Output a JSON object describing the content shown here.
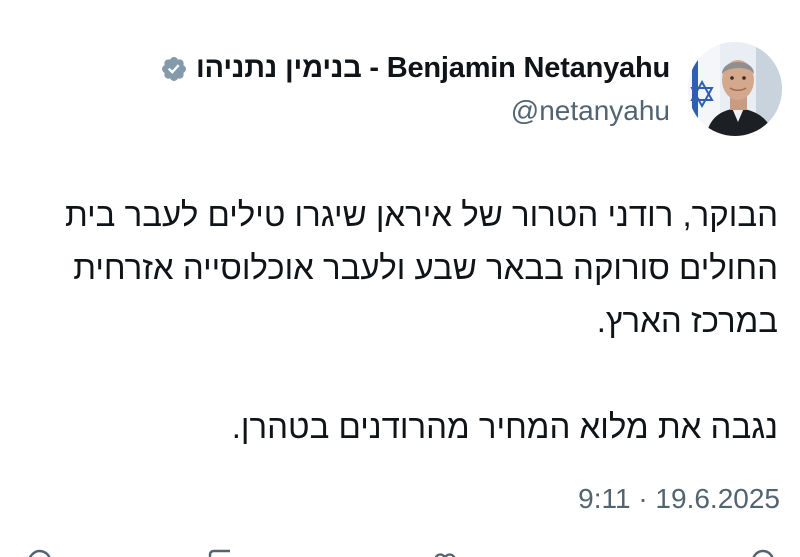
{
  "tweet": {
    "author": {
      "display_name": "Benjamin Netanyahu - בנימין נתניהו",
      "handle": "@netanyahu",
      "verified_icon": "verified-badge-icon",
      "avatar": "avatar-icon"
    },
    "body": {
      "paragraph_1": "הבוקר, רודני הטרור של איראן שיגרו טילים לעבר בית החולים סורוקה בבאר שבע ולעבר אוכלוסייה אזרחית במרכז הארץ.",
      "paragraph_2": "נגבה את מלוא המחיר מהרודנים בטהרן."
    },
    "timestamp": "9:11 · 19.6.2025",
    "actions": [
      "reply-icon",
      "repost-icon",
      "like-icon",
      "share-icon"
    ]
  },
  "colors": {
    "text_primary": "#0f1419",
    "text_secondary": "#536471",
    "verified_badge": "#829aab",
    "background": "#ffffff"
  }
}
